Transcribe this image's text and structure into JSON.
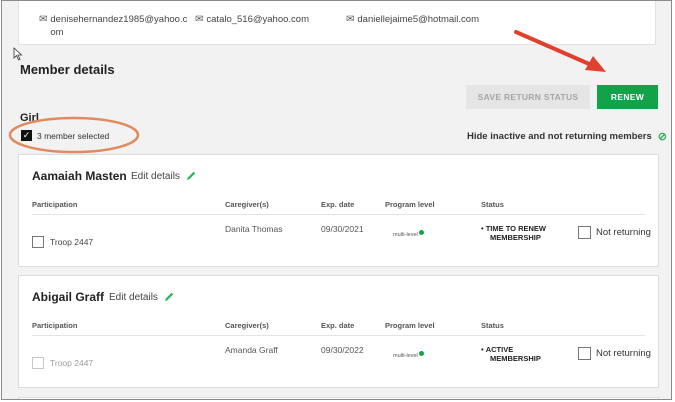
{
  "emails": [
    {
      "address": "denisehernandez1985@yahoo.com"
    },
    {
      "address": "catalo_516@yahoo.com"
    },
    {
      "address": "daniellejaime5@hotmail.com"
    }
  ],
  "section": {
    "title": "Member details",
    "group_label": "Girl",
    "selected_text": "3 member selected",
    "hide_link": "Hide inactive and not returning members"
  },
  "buttons": {
    "save_return_status": "SAVE RETURN STATUS",
    "renew": "RENEW"
  },
  "columns": {
    "participation": "Participation",
    "caregivers": "Caregiver(s)",
    "exp_date": "Exp. date",
    "program_level": "Program level",
    "status": "Status"
  },
  "edit_label": "Edit details",
  "members": [
    {
      "name": "Aamaiah Masten",
      "caregiver": "Danita Thomas",
      "exp_date": "09/30/2021",
      "troop": "Troop 2447",
      "program_level": "multi-level",
      "status_line1": "TIME TO RENEW",
      "status_line2": "MEMBERSHIP",
      "not_returning": "Not returning"
    },
    {
      "name": "Abigail Graff",
      "caregiver": "Amanda Graff",
      "exp_date": "09/30/2022",
      "troop": "Troop 2447",
      "program_level": "multi-level",
      "status_line1": "ACTIVE",
      "status_line2": "MEMBERSHIP",
      "not_returning": "Not returning"
    }
  ],
  "colors": {
    "accent_green": "#12a34a",
    "annotation_red": "#e0402e",
    "annotation_orange": "#e08a5e"
  }
}
